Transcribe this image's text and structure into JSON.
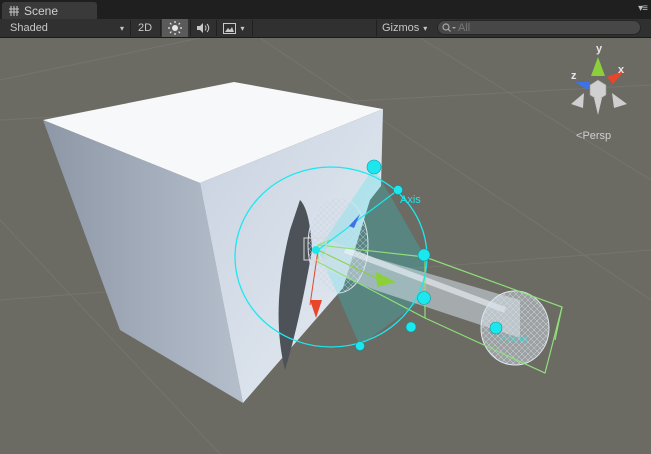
{
  "tab": {
    "title": "Scene",
    "icon": "scene-grid-icon"
  },
  "toolbar": {
    "draw_mode": "Shaded",
    "mode_2d": "2D",
    "lighting_icon": "sun-icon",
    "audio_icon": "speaker-icon",
    "effects_icon": "image-icon",
    "gizmos": "Gizmos",
    "search_placeholder": "All"
  },
  "viewport": {
    "axis_labels": {
      "y": "y",
      "x": "x",
      "z": "z"
    },
    "projection": "Persp",
    "overlay_labels": {
      "axis": "Axis",
      "swing": "Swing"
    }
  },
  "colors": {
    "background": "#6b6a63",
    "handle_cyan": "#1de7ee",
    "bounds_green": "#8ee07a",
    "axis_x": "#e8462a",
    "axis_y": "#8bd03a",
    "axis_z": "#3e73e8"
  }
}
